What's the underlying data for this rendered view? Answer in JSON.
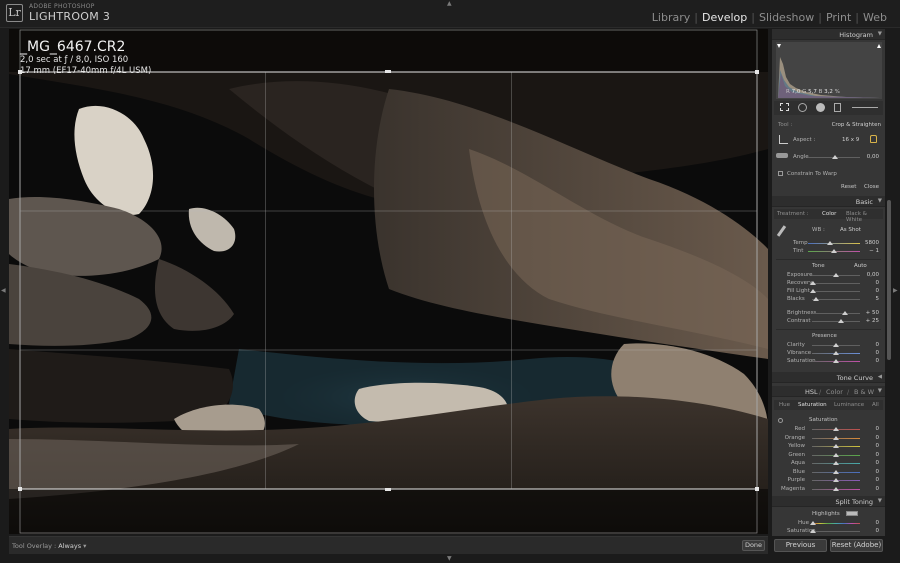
{
  "app": {
    "brand_top": "ADOBE PHOTOSHOP",
    "brand_main": "LIGHTROOM 3",
    "logo": "Lr",
    "modules": [
      "Library",
      "Develop",
      "Slideshow",
      "Print",
      "Web"
    ],
    "active_module": "Develop"
  },
  "photo": {
    "filename": "_MG_6467.CR2",
    "exposure_line": "2,0 sec at ƒ / 8,0, ISO 160",
    "lens_line": "17 mm (EF17-40mm f/4L USM)"
  },
  "toolbar": {
    "overlay_label": "Tool Overlay :",
    "overlay_value": "Always",
    "done_label": "Done"
  },
  "panel": {
    "histogram": {
      "title": "Histogram",
      "readout_r_label": "R",
      "readout_r": "7,0",
      "readout_g_label": "G",
      "readout_g": "5,7",
      "readout_b_label": "B",
      "readout_b": "3,2",
      "readout_unit": "%"
    },
    "crop": {
      "tool_label": "Tool :",
      "tool_name": "Crop & Straighten",
      "aspect_label": "Aspect :",
      "aspect_value": "16 x 9",
      "angle_label": "Angle",
      "angle_value": "0,00",
      "constrain_label": "Constrain To Warp",
      "reset_label": "Reset",
      "close_label": "Close"
    },
    "basic": {
      "title": "Basic",
      "treatment_label": "Treatment :",
      "treatment_color": "Color",
      "treatment_bw": "Black & White",
      "wb_label": "WB :",
      "wb_value": "As Shot",
      "temp_label": "Temp",
      "temp_value": "5800",
      "tint_label": "Tint",
      "tint_value": "− 1",
      "tone_label": "Tone",
      "auto_label": "Auto",
      "exposure_label": "Exposure",
      "exposure_value": "0,00",
      "recovery_label": "Recovery",
      "recovery_value": "0",
      "filllight_label": "Fill Light",
      "filllight_value": "0",
      "blacks_label": "Blacks",
      "blacks_value": "5",
      "brightness_label": "Brightness",
      "brightness_value": "+ 50",
      "contrast_label": "Contrast",
      "contrast_value": "+ 25",
      "presence_label": "Presence",
      "clarity_label": "Clarity",
      "clarity_value": "0",
      "vibrance_label": "Vibrance",
      "vibrance_value": "0",
      "saturation_label": "Saturation",
      "saturation_value": "0"
    },
    "tone_curve": {
      "title": "Tone Curve"
    },
    "hsl": {
      "tab_hsl": "HSL",
      "tab_color": "Color",
      "tab_bw": "B & W",
      "sub_hue": "Hue",
      "sub_saturation": "Saturation",
      "sub_luminance": "Luminance",
      "sub_all": "All",
      "group_label": "Saturation",
      "rows": [
        {
          "label": "Red",
          "value": "0",
          "color": "#c0504d"
        },
        {
          "label": "Orange",
          "value": "0",
          "color": "#d88a3a"
        },
        {
          "label": "Yellow",
          "value": "0",
          "color": "#cfc33c"
        },
        {
          "label": "Green",
          "value": "0",
          "color": "#5aa84a"
        },
        {
          "label": "Aqua",
          "value": "0",
          "color": "#46a9a9"
        },
        {
          "label": "Blue",
          "value": "0",
          "color": "#4a6fc0"
        },
        {
          "label": "Purple",
          "value": "0",
          "color": "#8a5ab8"
        },
        {
          "label": "Magenta",
          "value": "0",
          "color": "#c050a8"
        }
      ]
    },
    "split_toning": {
      "title": "Split Toning",
      "highlights_label": "Highlights",
      "hue_label": "Hue",
      "hue_value": "0",
      "saturation_label": "Saturation",
      "saturation_value": "0"
    }
  },
  "footer": {
    "previous_label": "Previous",
    "reset_label": "Reset (Adobe)"
  }
}
